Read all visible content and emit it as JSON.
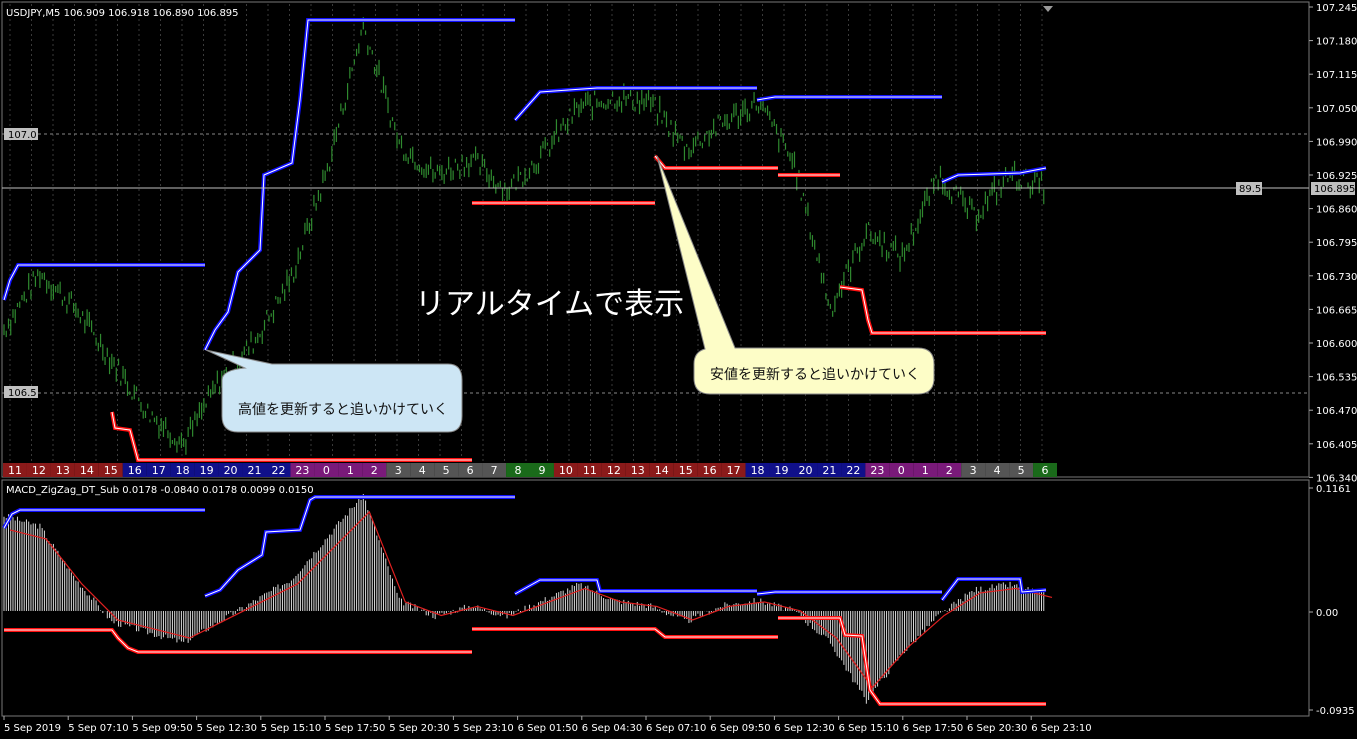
{
  "symbol_header": "USDJPY,M5  106.909 106.918 106.890 106.895",
  "indicator_header": "MACD_ZigZag_DT_Sub 0.0178 -0.0840 0.0178 0.0099 0.0150",
  "main_price_axis": [
    "107.245",
    "107.180",
    "107.115",
    "107.050",
    "106.990",
    "106.925",
    "106.860",
    "106.795",
    "106.730",
    "106.665",
    "106.600",
    "106.535",
    "106.470",
    "106.405",
    "106.340"
  ],
  "current_price_label": "106.895",
  "crosshair_value_label": "89.5",
  "level_labels": [
    "107.0",
    "106.5"
  ],
  "sub_axis": [
    "0.1161",
    "0.00",
    "-0.0935"
  ],
  "hour_labels": [
    "11",
    "12",
    "13",
    "14",
    "15",
    "16",
    "17",
    "18",
    "19",
    "20",
    "21",
    "22",
    "23",
    "0",
    "1",
    "2",
    "3",
    "4",
    "5",
    "6",
    "7",
    "8",
    "9",
    "10",
    "11",
    "12",
    "13",
    "14",
    "15",
    "16",
    "17",
    "18",
    "19",
    "20",
    "21",
    "22",
    "23",
    "0",
    "1",
    "2",
    "3",
    "4",
    "5",
    "6"
  ],
  "time_labels": [
    "5 Sep 2019",
    "5 Sep 07:10",
    "5 Sep 09:50",
    "5 Sep 12:30",
    "5 Sep 15:10",
    "5 Sep 17:50",
    "5 Sep 20:30",
    "5 Sep 23:10",
    "6 Sep 01:50",
    "6 Sep 04:30",
    "6 Sep 07:10",
    "6 Sep 09:50",
    "6 Sep 12:30",
    "6 Sep 15:10",
    "6 Sep 17:50",
    "6 Sep 20:30",
    "6 Sep 23:10"
  ],
  "annotation_main": "リアルタイムで表示",
  "callout_high": "高値を更新すると追いかけていく",
  "callout_low": "安値を更新すると追いかけていく",
  "colors": {
    "bull": "#2f8a2f",
    "high_line": "#1010ff",
    "low_line": "#ff1010",
    "callout": "#fdfdc7",
    "callout_blue": "#cde6f5",
    "grid": "#555",
    "axis_text": "#fff"
  },
  "chart_data": [
    {
      "type": "line",
      "title": "USDJPY,M5",
      "ylim": [
        106.34,
        107.245
      ],
      "x": [
        "5 Sep 2019",
        "5 Sep 07:10",
        "5 Sep 09:50",
        "5 Sep 12:30",
        "5 Sep 15:10",
        "5 Sep 17:50",
        "5 Sep 20:30",
        "5 Sep 23:10",
        "6 Sep 01:50",
        "6 Sep 04:30",
        "6 Sep 07:10",
        "6 Sep 09:50",
        "6 Sep 12:30",
        "6 Sep 15:10",
        "6 Sep 17:50",
        "6 Sep 20:30",
        "6 Sep 23:10"
      ],
      "series": [
        {
          "values": [
            106.62,
            106.73,
            106.66,
            106.56,
            106.46,
            106.4,
            106.52,
            106.6,
            106.72,
            106.93,
            107.21,
            106.98,
            106.92,
            106.95,
            106.89,
            106.96,
            107.05,
            107.07,
            107.06,
            106.97,
            107.02,
            107.06,
            106.94,
            106.66,
            106.81,
            106.76,
            106.92,
            106.84,
            106.92,
            106.895
          ]
        }
      ]
    },
    {
      "type": "bar",
      "title": "MACD_ZigZag_DT_Sub",
      "ylim": [
        -0.0935,
        0.1161
      ],
      "series": [
        {
          "values": [
            0.09,
            0.08,
            0.03,
            -0.01,
            -0.02,
            -0.03,
            -0.01,
            0.01,
            0.03,
            0.07,
            0.11,
            0.01,
            -0.005,
            0.005,
            -0.005,
            0.01,
            0.025,
            0.01,
            0.005,
            -0.01,
            0.005,
            0.01,
            0.0,
            -0.03,
            -0.085,
            -0.04,
            -0.005,
            0.02,
            0.025,
            0.015
          ]
        }
      ]
    }
  ]
}
